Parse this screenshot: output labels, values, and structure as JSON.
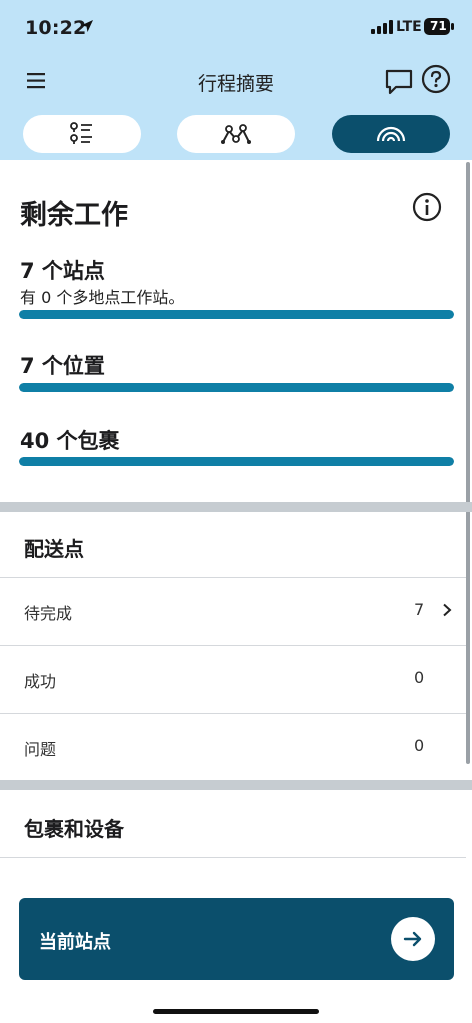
{
  "status_bar": {
    "time": "10:22",
    "network": "LTE",
    "battery": "71"
  },
  "header": {
    "title": "行程摘要"
  },
  "tabs": [
    {
      "icon": "list-stops-icon",
      "active": false
    },
    {
      "icon": "route-map-icon",
      "active": false
    },
    {
      "icon": "rainbow-progress-icon",
      "active": true
    }
  ],
  "remaining_work": {
    "title": "剩余工作",
    "stops": {
      "label": "7 个站点",
      "note": "有 0 个多地点工作站。",
      "progress": 1.0
    },
    "locations": {
      "label": "7 个位置",
      "progress": 1.0
    },
    "packages": {
      "label": "40 个包裹",
      "progress": 1.0
    }
  },
  "delivery_points": {
    "title": "配送点",
    "rows": [
      {
        "label": "待完成",
        "value": "7"
      },
      {
        "label": "成功",
        "value": "0"
      },
      {
        "label": "问题",
        "value": "0"
      }
    ]
  },
  "packages_devices": {
    "title": "包裹和设备"
  },
  "cta": {
    "label": "当前站点"
  },
  "colors": {
    "header_bg": "#bfe3f8",
    "primary": "#0b4f6c",
    "bar": "#0f7fa6"
  }
}
